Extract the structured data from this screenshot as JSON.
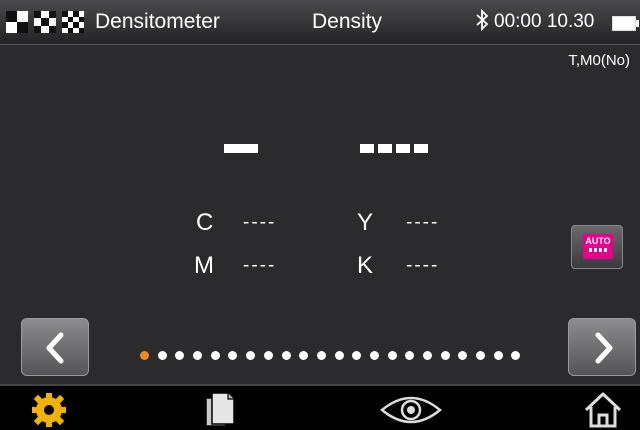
{
  "status_bar": {
    "app_title": "Densitometer",
    "mode_title": "Density",
    "bluetooth_icon": "bluetooth-icon",
    "time": "00:00 10.30",
    "battery_icon": "battery-icon"
  },
  "measurement_condition": "T,M0(No)",
  "main": {
    "big_value_left": "--",
    "big_value_right": "----",
    "channels": [
      {
        "label": "C",
        "value": "----"
      },
      {
        "label": "Y",
        "value": "----"
      },
      {
        "label": "M",
        "value": "----"
      },
      {
        "label": "K",
        "value": "----"
      }
    ]
  },
  "auto_button": {
    "label": "AUTO",
    "color": "#e8008c"
  },
  "pager": {
    "total_pages": 22,
    "current_page": 1,
    "active_color": "#f08a1c"
  },
  "nav": {
    "prev_icon": "chevron-left-icon",
    "next_icon": "chevron-right-icon"
  },
  "toolbar": [
    {
      "icon": "gear-icon"
    },
    {
      "icon": "documents-icon"
    },
    {
      "icon": "eye-icon"
    },
    {
      "icon": "home-icon"
    }
  ]
}
